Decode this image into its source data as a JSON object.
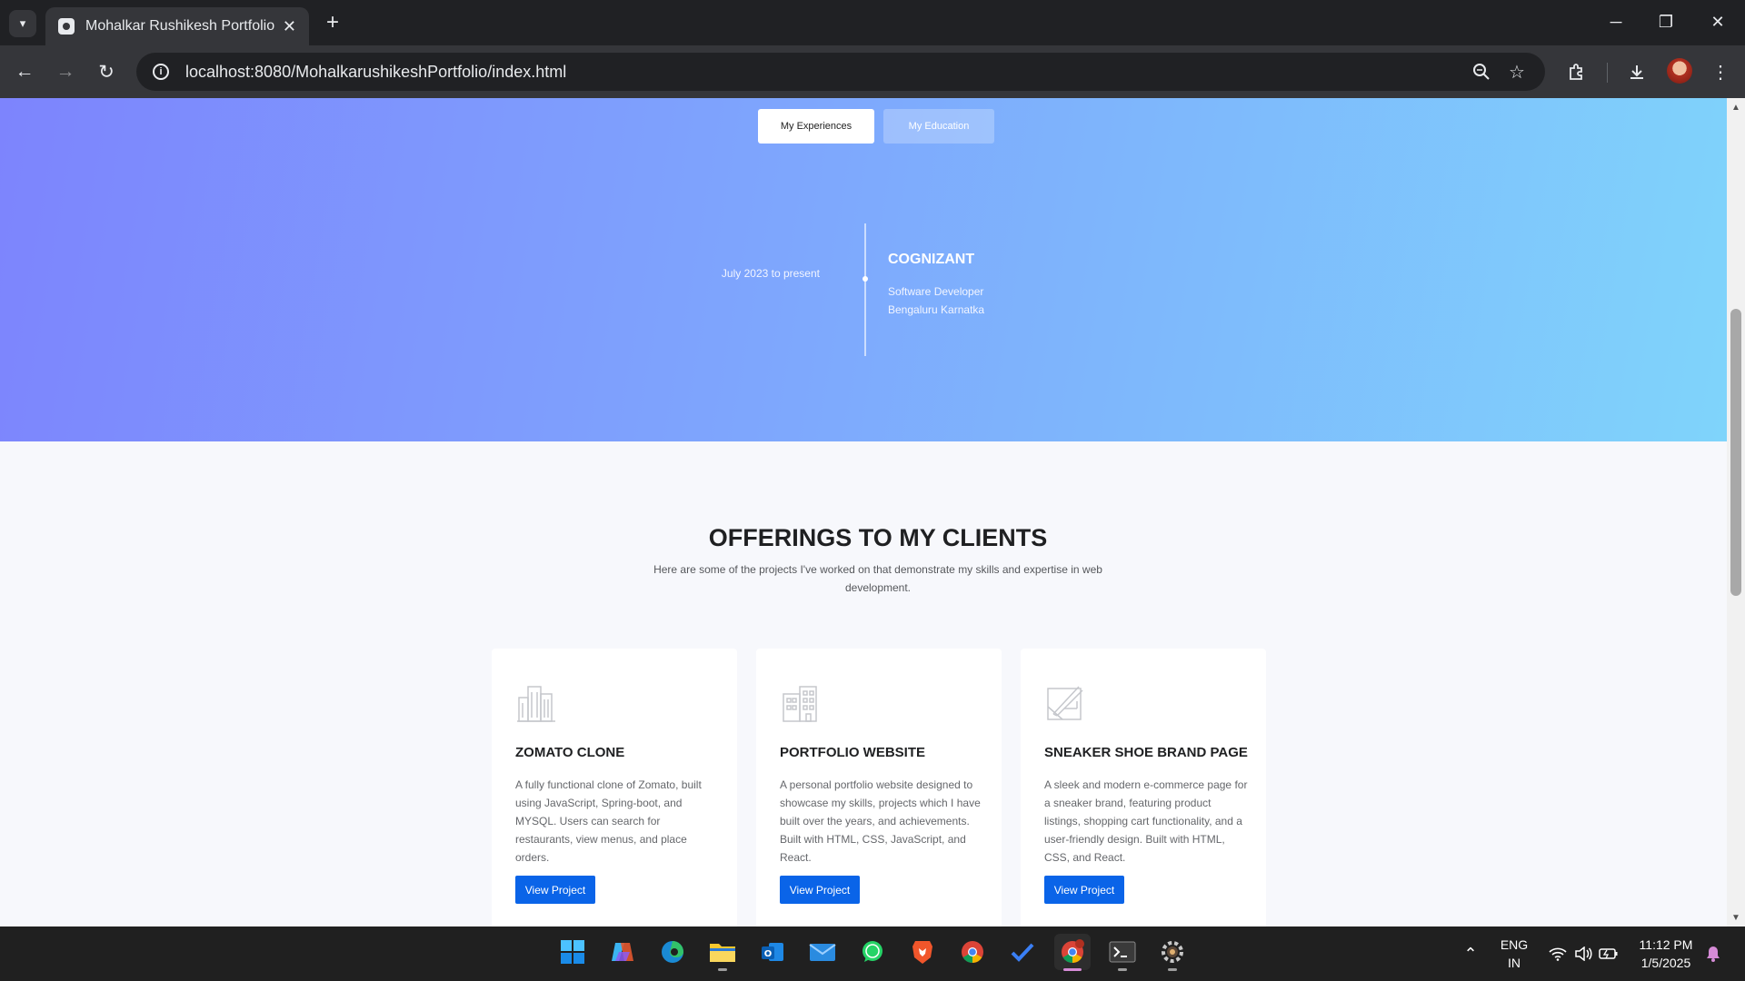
{
  "browser": {
    "tab_title": "Mohalkar Rushikesh Portfolio",
    "url": "localhost:8080/MohalkarushikeshPortfolio/index.html",
    "tab_list_icon": "chevron-down-icon",
    "close_tab_glyph": "✕",
    "new_tab_glyph": "+",
    "window_controls": [
      "minimize-icon",
      "restore-icon",
      "close-icon"
    ],
    "toolbar_icons": [
      "zoom-icon",
      "bookmark-star-icon",
      "extensions-icon",
      "downloads-icon",
      "profile-avatar",
      "menu-icon"
    ]
  },
  "experience": {
    "tabs": [
      {
        "label": "My Experiences",
        "active": true
      },
      {
        "label": "My Education",
        "active": false
      }
    ],
    "items": [
      {
        "period": "July 2023 to present",
        "company": "COGNIZANT",
        "role": "Software Developer",
        "location": "Bengaluru Karnatka"
      }
    ]
  },
  "offerings": {
    "title": "OFFERINGS TO MY CLIENTS",
    "subtitle": "Here are some of the projects I've worked on that demonstrate my skills and expertise in web development.",
    "cards": [
      {
        "icon": "building-icon",
        "title": "ZOMATO CLONE",
        "description": "A fully functional clone of Zomato, built using JavaScript, Spring-boot, and MYSQL. Users can search for restaurants, view menus, and place orders.",
        "button": "View Project"
      },
      {
        "icon": "office-building-icon",
        "title": "PORTFOLIO WEBSITE",
        "description": "A personal portfolio website designed to showcase my skills, projects which I have built over the years, and achievements. Built with HTML, CSS, JavaScript, and React.",
        "button": "View Project"
      },
      {
        "icon": "design-tools-icon",
        "title": "SNEAKER SHOE BRAND PAGE",
        "description": "A sleek and modern e-commerce page for a sneaker brand, featuring product listings, shopping cart functionality, and a user-friendly design. Built with HTML, CSS, and React.",
        "button": "View Project"
      }
    ]
  },
  "taskbar": {
    "apps": [
      "start-icon",
      "copilot-icon",
      "edge-icon",
      "file-explorer-icon",
      "outlook-icon",
      "mail-icon",
      "whatsapp-icon",
      "brave-icon",
      "chrome-icon",
      "todo-icon",
      "chrome-profile-icon",
      "terminal-icon",
      "settings-icon"
    ],
    "language": "ENG",
    "region": "IN",
    "time": "11:12 PM",
    "date": "1/5/2025"
  },
  "colors": {
    "accent_button": "#0a64e8",
    "hero_gradient_start": "#7d84fd",
    "hero_gradient_end": "#7fd4fb"
  }
}
